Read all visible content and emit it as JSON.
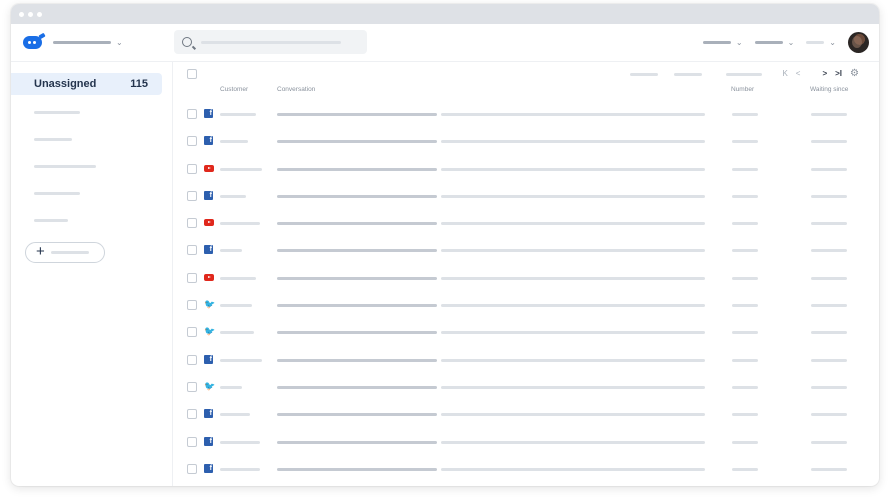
{
  "window": {
    "controls": [
      "close",
      "minimize",
      "maximize"
    ]
  },
  "topbar": {
    "logo_icon": "chat-bubble-logo",
    "search_icon": "search-icon",
    "avatar_icon": "user-avatar"
  },
  "sidebar": {
    "active_item": {
      "label": "Unassigned",
      "count": "115"
    },
    "add_icon": "plus-icon"
  },
  "table": {
    "headers": {
      "customer": "Customer",
      "conversation": "Conversation",
      "number": "Number",
      "waiting_since": "Waiting since"
    },
    "pager_icons": {
      "first": "K",
      "prev": "<",
      "next": ">",
      "last": ">I",
      "settings": "gear-icon"
    },
    "rows": [
      {
        "channel": "facebook",
        "cust_w": 36
      },
      {
        "channel": "facebook",
        "cust_w": 28
      },
      {
        "channel": "youtube",
        "cust_w": 42
      },
      {
        "channel": "facebook",
        "cust_w": 26
      },
      {
        "channel": "youtube",
        "cust_w": 40
      },
      {
        "channel": "facebook",
        "cust_w": 22
      },
      {
        "channel": "youtube",
        "cust_w": 36
      },
      {
        "channel": "twitter",
        "cust_w": 32
      },
      {
        "channel": "twitter",
        "cust_w": 34
      },
      {
        "channel": "facebook",
        "cust_w": 42
      },
      {
        "channel": "twitter",
        "cust_w": 22
      },
      {
        "channel": "facebook",
        "cust_w": 30
      },
      {
        "channel": "facebook",
        "cust_w": 40
      },
      {
        "channel": "facebook",
        "cust_w": 40
      }
    ]
  },
  "colors": {
    "accent": "#1a6ee6",
    "active_bg": "#e8f0fb",
    "facebook": "#2d5fae",
    "youtube": "#e0281c",
    "twitter": "#1d9bf0"
  }
}
